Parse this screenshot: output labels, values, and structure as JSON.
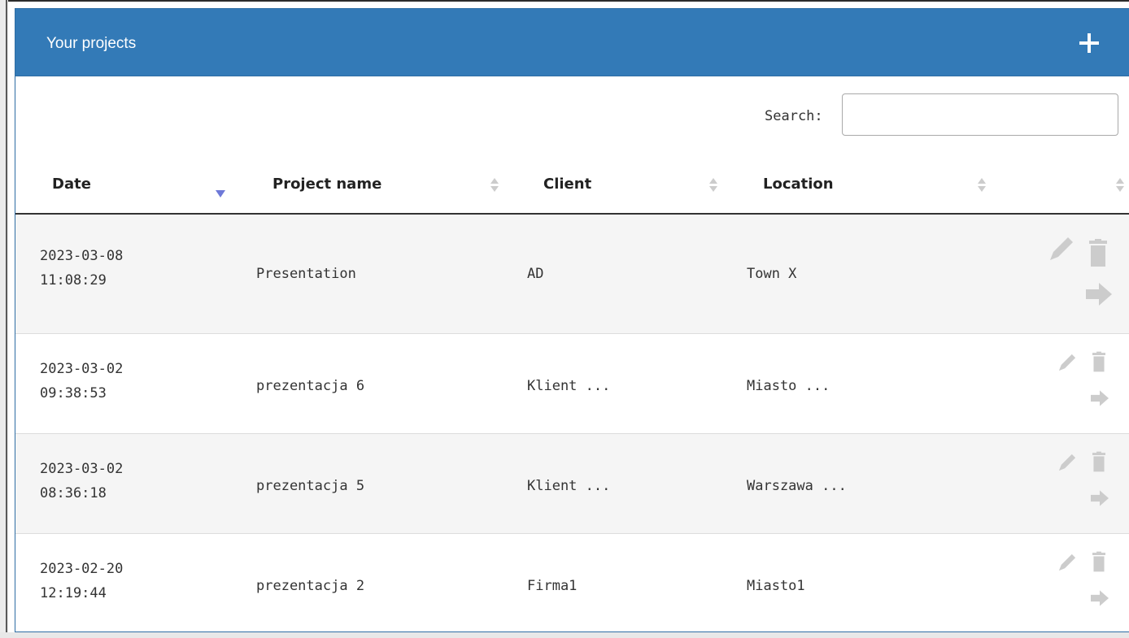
{
  "panel": {
    "title": "Your projects",
    "add_icon": "plus-icon"
  },
  "search": {
    "label": "Search:",
    "value": "",
    "placeholder": ""
  },
  "table": {
    "columns": [
      {
        "label": "Date",
        "sort": "descending"
      },
      {
        "label": "Project name",
        "sort": "none"
      },
      {
        "label": "Client",
        "sort": "none"
      },
      {
        "label": "Location",
        "sort": "none"
      },
      {
        "label": "",
        "sort": "none"
      }
    ],
    "rows": [
      {
        "date": "2023-03-08",
        "time": "11:08:29",
        "project": "Presentation",
        "client": "AD",
        "location": "Town X"
      },
      {
        "date": "2023-03-02",
        "time": "09:38:53",
        "project": "prezentacja 6",
        "client": "Klient ...",
        "location": "Miasto ..."
      },
      {
        "date": "2023-03-02",
        "time": "08:36:18",
        "project": "prezentacja 5",
        "client": "Klient ...",
        "location": "Warszawa ..."
      },
      {
        "date": "2023-02-20",
        "time": "12:19:44",
        "project": "prezentacja 2",
        "client": "Firma1",
        "location": "Miasto1"
      }
    ],
    "row_actions": [
      "pencil-icon",
      "trash-icon",
      "arrow-right-icon"
    ]
  },
  "colors": {
    "header_bg": "#337ab7",
    "sort_active": "#6e79d8",
    "icon_gray": "#cccccc"
  }
}
